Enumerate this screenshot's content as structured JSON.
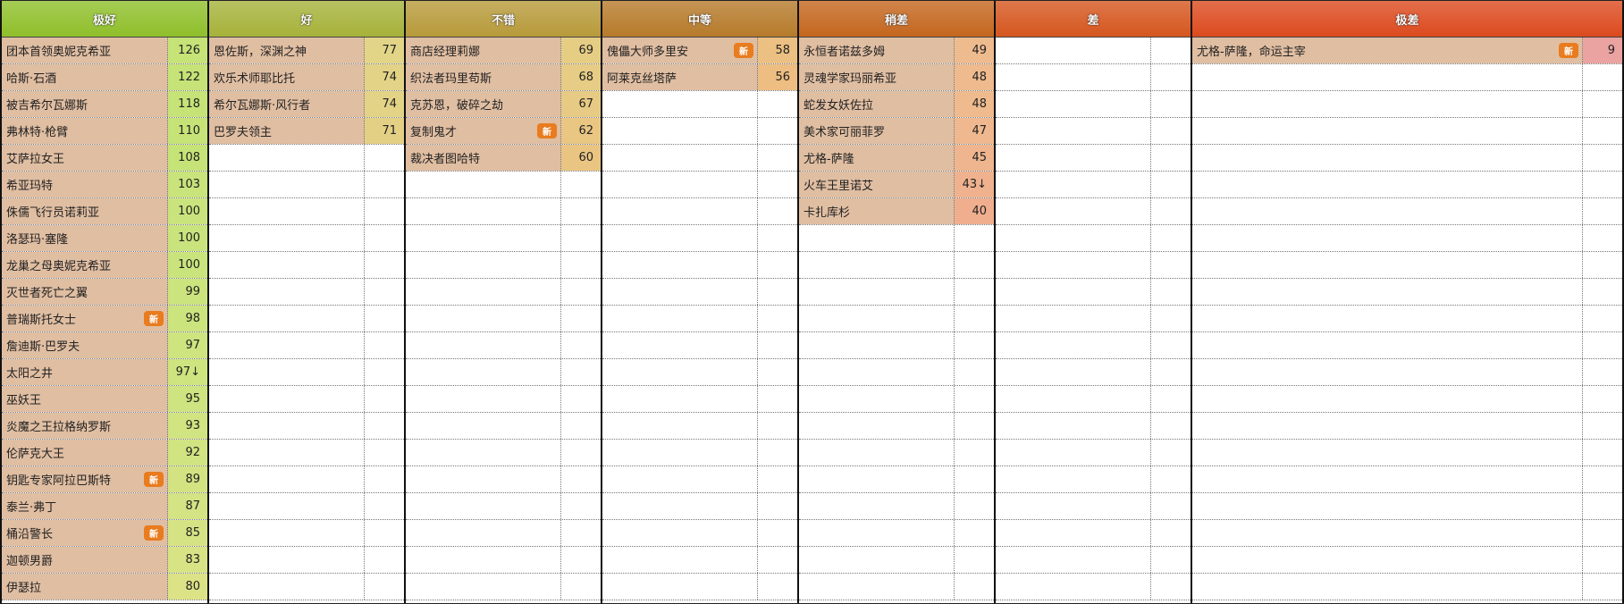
{
  "badge_label": "新",
  "columns": [
    {
      "title": "极好",
      "header_color": "#8fbf2a",
      "score_color": "#cfe585",
      "entries": [
        {
          "name": "团本首领奥妮克希亚",
          "score": "126",
          "new": false,
          "score_color": "#c6e377"
        },
        {
          "name": "哈斯·石酒",
          "score": "122",
          "new": false,
          "score_color": "#c6e377"
        },
        {
          "name": "被吉希尔瓦娜斯",
          "score": "118",
          "new": false,
          "score_color": "#c6e377"
        },
        {
          "name": "弗林特·枪臂",
          "score": "110",
          "new": false,
          "score_color": "#c6e377"
        },
        {
          "name": "艾萨拉女王",
          "score": "108",
          "new": false,
          "score_color": "#c6e377"
        },
        {
          "name": "希亚玛特",
          "score": "103",
          "new": false,
          "score_color": "#c8e47b"
        },
        {
          "name": "侏儒飞行员诺莉亚",
          "score": "100",
          "new": false,
          "score_color": "#cae47d"
        },
        {
          "name": "洛瑟玛·塞隆",
          "score": "100",
          "new": false,
          "score_color": "#cae47d"
        },
        {
          "name": "龙巢之母奥妮克希亚",
          "score": "100",
          "new": false,
          "score_color": "#cae47d"
        },
        {
          "name": "灭世者死亡之翼",
          "score": "99",
          "new": false,
          "score_color": "#cce47e"
        },
        {
          "name": "普瑞斯托女士",
          "score": "98",
          "new": true,
          "score_color": "#cce47e"
        },
        {
          "name": "詹迪斯·巴罗夫",
          "score": "97",
          "new": false,
          "score_color": "#cde47f"
        },
        {
          "name": "太阳之井",
          "score": "97↓",
          "new": false,
          "score_color": "#cde47f"
        },
        {
          "name": "巫妖王",
          "score": "95",
          "new": false,
          "score_color": "#cee480"
        },
        {
          "name": "炎魔之王拉格纳罗斯",
          "score": "93",
          "new": false,
          "score_color": "#d0e481"
        },
        {
          "name": "伦萨克大王",
          "score": "92",
          "new": false,
          "score_color": "#d0e481"
        },
        {
          "name": "钥匙专家阿拉巴斯特",
          "score": "89",
          "new": true,
          "score_color": "#d3e382"
        },
        {
          "name": "泰兰·弗丁",
          "score": "87",
          "new": false,
          "score_color": "#d4e383"
        },
        {
          "name": "桶沿警长",
          "score": "85",
          "new": true,
          "score_color": "#d6e384"
        },
        {
          "name": "迦顿男爵",
          "score": "83",
          "new": false,
          "score_color": "#d8e385"
        },
        {
          "name": "伊瑟拉",
          "score": "80",
          "new": false,
          "score_color": "#dbe386"
        }
      ]
    },
    {
      "title": "好",
      "header_color": "#a6b23a",
      "entries": [
        {
          "name": "恩佐斯，深渊之神",
          "score": "77",
          "new": false,
          "score_color": "#e2d587"
        },
        {
          "name": "欢乐术师耶比托",
          "score": "74",
          "new": false,
          "score_color": "#e3d386"
        },
        {
          "name": "希尔瓦娜斯·风行者",
          "score": "74",
          "new": false,
          "score_color": "#e3d386"
        },
        {
          "name": "巴罗夫领主",
          "score": "71",
          "new": false,
          "score_color": "#e4d085"
        }
      ]
    },
    {
      "title": "不错",
      "header_color": "#b79a3a",
      "entries": [
        {
          "name": "商店经理莉娜",
          "score": "69",
          "new": false,
          "score_color": "#e6cd84"
        },
        {
          "name": "织法者玛里苟斯",
          "score": "68",
          "new": false,
          "score_color": "#e6cc84"
        },
        {
          "name": "克苏恩，破碎之劫",
          "score": "67",
          "new": false,
          "score_color": "#e7ca83"
        },
        {
          "name": "复制鬼才",
          "score": "62",
          "new": true,
          "score_color": "#e9c682"
        },
        {
          "name": "裁决者图哈特",
          "score": "60",
          "new": false,
          "score_color": "#eac481"
        }
      ]
    },
    {
      "title": "中等",
      "header_color": "#b67a2a",
      "entries": [
        {
          "name": "傀儡大师多里安",
          "score": "58",
          "new": true,
          "score_color": "#ecc082"
        },
        {
          "name": "阿莱克丝塔萨",
          "score": "56",
          "new": false,
          "score_color": "#edbd81"
        }
      ]
    },
    {
      "title": "稍差",
      "header_color": "#c4661e",
      "entries": [
        {
          "name": "永恒者诺兹多姆",
          "score": "49",
          "new": false,
          "score_color": "#eebb8e"
        },
        {
          "name": "灵魂学家玛丽希亚",
          "score": "48",
          "new": false,
          "score_color": "#eeba8e"
        },
        {
          "name": "蛇发女妖佐拉",
          "score": "48",
          "new": false,
          "score_color": "#eeba8e"
        },
        {
          "name": "美术家可丽菲罗",
          "score": "47",
          "new": false,
          "score_color": "#efb88e"
        },
        {
          "name": "尤格-萨隆",
          "score": "45",
          "new": false,
          "score_color": "#efb58e"
        },
        {
          "name": "火车王里诺艾",
          "score": "43↓",
          "new": false,
          "score_color": "#f0b28e"
        },
        {
          "name": "卡扎库杉",
          "score": "40",
          "new": false,
          "score_color": "#f0ae8e"
        }
      ]
    },
    {
      "title": "差",
      "header_color": "#d5561e",
      "entries": []
    },
    {
      "title": "极差",
      "header_color": "#dc4a1e",
      "entries": [
        {
          "name": "尤格-萨隆，命运主宰",
          "score": "9",
          "new": true,
          "score_color": "#eaa3a1"
        }
      ]
    }
  ]
}
